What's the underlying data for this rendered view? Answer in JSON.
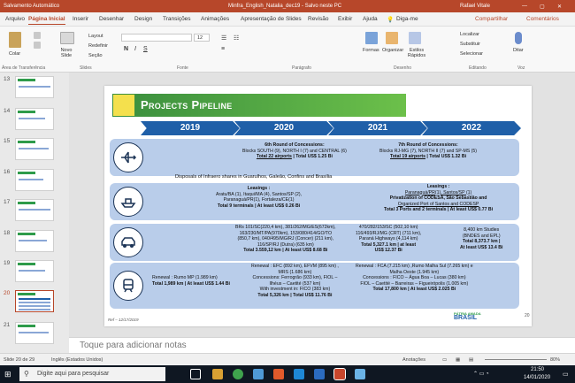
{
  "titlebar": {
    "autosave": "Salvamento Automático",
    "doc_title": "Minfra_English_Natalia_dec19 - Salvo neste PC",
    "user": "Rafael Vitale"
  },
  "menu": {
    "items": [
      "Arquivo",
      "Página Inicial",
      "Inserir",
      "Desenhar",
      "Design",
      "Transições",
      "Animações",
      "Apresentação de Slides",
      "Revisão",
      "Exibir",
      "Ajuda"
    ],
    "tell_me": "Diga-me",
    "share": "Compartilhar",
    "comments": "Comentários"
  },
  "ribbon": {
    "paste": "Colar",
    "new_slide": "Novo Slide",
    "layout": "Layout",
    "reset": "Redefinir",
    "section": "Seção",
    "font_size": "12",
    "shapes": "Formas",
    "arrange": "Organizar",
    "quick_styles": "Estilos Rápidos",
    "find": "Localizar",
    "replace": "Substituir",
    "select": "Selecionar",
    "dictate": "Ditar",
    "groups": {
      "clipboard": "Área de Transferência",
      "slides": "Slides",
      "font": "Fonte",
      "paragraph": "Parágrafo",
      "drawing": "Desenho",
      "editing": "Editando",
      "voice": "Voz"
    }
  },
  "thumbnails": [
    {
      "num": "13"
    },
    {
      "num": "14"
    },
    {
      "num": "15"
    },
    {
      "num": "16"
    },
    {
      "num": "17"
    },
    {
      "num": "18"
    },
    {
      "num": "19"
    },
    {
      "num": "20"
    },
    {
      "num": "21"
    }
  ],
  "slide": {
    "title": "Projects Pipeline",
    "years": [
      "2019",
      "2020",
      "2021",
      "2022"
    ],
    "airports": {
      "c6_title": "6th Round of Concessions:",
      "c6_blocks": "Blocks SOUTH (9), NORTH I (7) and CENTRAL (6)",
      "c6_total_a": "Total 22 airports",
      "c6_total_b": " | Total US$ 1.25 Bi",
      "c7_title": "7th Round of Concessions:",
      "c7_blocks": "Blocks RJ-MG (7), NORTH II (7) and SP-MS (5)",
      "c7_total_a": "Total 19 airports",
      "c7_total_b": " | Total US$ 1.32 Bi",
      "disposals": "Disposals of Infraero shares in Guarulhos, Galeão, Confins and Brasília"
    },
    "ports": {
      "l1_title": "Leasings :",
      "l1_a": "Aratu/BA (1), Itaqui/MA (4), Santos/SP (2),",
      "l1_b": "Paranaguá/PR(1), Fortaleza/CE(1)",
      "l1_total": "Total 9 terminals | At least US$ 0.26 Bi",
      "l2_title": "Leasings :",
      "l2_a": "Paranaguá/PR(1), Santos/SP (1)",
      "l2_b": "Privatization of CODESA, São Sebastião and",
      "l2_c": "Organized Port of Santos and CODESP",
      "l2_total": "Total 3 Ports and 2 terminals | At least US$ 0.77 Bi"
    },
    "roads": {
      "r1_a": "BRs 101/SC(220,4 km), 381/262/MG/ES(672km),",
      "r1_b": "163/230/MT/PA(970km), 153/080/414/GO/TO",
      "r1_c": "(850,7 km), 040/495/MG/RJ (Concer) (211 km),",
      "r1_d": "116/SP/RJ (Dutra) (635 km)",
      "r1_total": "Total 3.559,12 km | At least US$ 8.68 Bi",
      "r2_a": "470/282/153/SC (502,10 km)",
      "r2_b": "116/493/RJ/MG (CRT) (711 km),",
      "r2_c": "Paraná Highways (4,114 km)",
      "r2_total": "Total 5,327.1 km | at least",
      "r2_total2": "US$ 12.37 Bi",
      "r3_a": "8,400 km Studies",
      "r3_b": "(BNDES and EPL)",
      "r3_total": "Total 8,373.7 km |",
      "r3_total2": "At least US$ 13.4 Bi"
    },
    "rail": {
      "ren1": "Renewal : Rumo MP (1.989 km)",
      "ren1_total": "Total 1,989 km | At least US$ 1.44 Bi",
      "ren2_a": "Renewal : EFC (892 km), EFVM (895 km) ,",
      "ren2_b": "MRS (1.686 km)",
      "con2_a": "Concessions: Ferrogrão (933 km), FIOL –",
      "con2_b": "Ilhéus – Caetité (537 km)",
      "inv2": "With investment in: FICO (383 km)",
      "tot2": "Total 5,326 km | Total US$ 11.76 Bi",
      "ren3_a": "Renewal : FCA (7.215 km) ,Rumo Malha Sul (7.265 km) e",
      "ren3_b": "Malha Oeste (1.945 km)",
      "con3_a": "Concessions : FICO – Água Boa – Lucas (380 km)",
      "con3_b": "FIOL – Caetité – Barreiras – Figueirópolis (1.005 km)",
      "tot3": "Total 17,800 km | At least US$ 2.025 Bi"
    },
    "footnote": "Ref – 12/17/2019",
    "page": "20",
    "brasil": "BRASIL",
    "patria": "PÁTRIA AMADA"
  },
  "notes_placeholder": "Toque para adicionar notas",
  "status": {
    "slide": "Slide 20 de 29",
    "lang": "Inglês (Estados Unidos)",
    "notes": "Anotações",
    "zoom": "80%"
  },
  "taskbar": {
    "search": "Digite aqui para pesquisar",
    "time": "21:50",
    "date": "14/01/2020"
  }
}
